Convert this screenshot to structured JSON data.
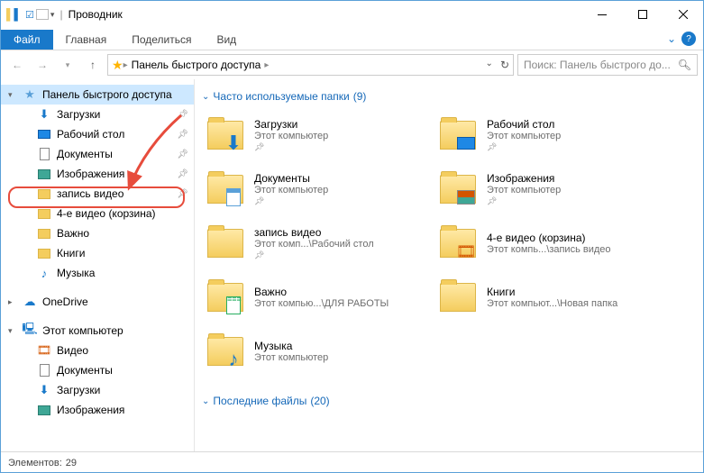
{
  "title": "Проводник",
  "tabs": {
    "file": "Файл",
    "home": "Главная",
    "share": "Поделиться",
    "view": "Вид"
  },
  "address": {
    "root": "Панель быстрого доступа"
  },
  "search": {
    "placeholder": "Поиск: Панель быстрого до..."
  },
  "nav": {
    "quick": "Панель быстрого доступа",
    "items": [
      {
        "label": "Загрузки",
        "icon": "download",
        "pinned": true
      },
      {
        "label": "Рабочий стол",
        "icon": "desktop",
        "pinned": true
      },
      {
        "label": "Документы",
        "icon": "docs",
        "pinned": true
      },
      {
        "label": "Изображения",
        "icon": "pics",
        "pinned": true
      },
      {
        "label": "запись видео",
        "icon": "folder",
        "pinned": true,
        "highlight": true
      },
      {
        "label": "4-е видео (корзина)",
        "icon": "folder",
        "pinned": false
      },
      {
        "label": "Важно",
        "icon": "folder",
        "pinned": false
      },
      {
        "label": "Книги",
        "icon": "folder",
        "pinned": false
      },
      {
        "label": "Музыка",
        "icon": "music",
        "pinned": false
      }
    ],
    "onedrive": "OneDrive",
    "thispc": "Этот компьютер",
    "pcitems": [
      {
        "label": "Видео",
        "icon": "video"
      },
      {
        "label": "Документы",
        "icon": "docs"
      },
      {
        "label": "Загрузки",
        "icon": "download"
      },
      {
        "label": "Изображения",
        "icon": "pics"
      }
    ]
  },
  "sections": {
    "frequent": {
      "title": "Часто используемые папки",
      "count": "(9)"
    },
    "recent": {
      "title": "Последние файлы",
      "count": "(20)"
    }
  },
  "tiles": [
    {
      "name": "Загрузки",
      "sub": "Этот компьютер",
      "pinned": true,
      "badge": "download"
    },
    {
      "name": "Рабочий стол",
      "sub": "Этот компьютер",
      "pinned": true,
      "badge": "desktop"
    },
    {
      "name": "Документы",
      "sub": "Этот компьютер",
      "pinned": true,
      "badge": "docs"
    },
    {
      "name": "Изображения",
      "sub": "Этот компьютер",
      "pinned": true,
      "badge": "pics"
    },
    {
      "name": "запись видео",
      "sub": "Этот комп...\\Рабочий стол",
      "pinned": true,
      "badge": ""
    },
    {
      "name": "4-е видео (корзина)",
      "sub": "Этот компь...\\запись видео",
      "pinned": false,
      "badge": "video"
    },
    {
      "name": "Важно",
      "sub": "Этот компью...\\ДЛЯ РАБОТЫ",
      "pinned": false,
      "badge": "list"
    },
    {
      "name": "Книги",
      "sub": "Этот компьют...\\Новая папка",
      "pinned": false,
      "badge": ""
    },
    {
      "name": "Музыка",
      "sub": "Этот компьютер",
      "pinned": false,
      "badge": "music"
    }
  ],
  "status": {
    "label": "Элементов:",
    "count": "29"
  }
}
